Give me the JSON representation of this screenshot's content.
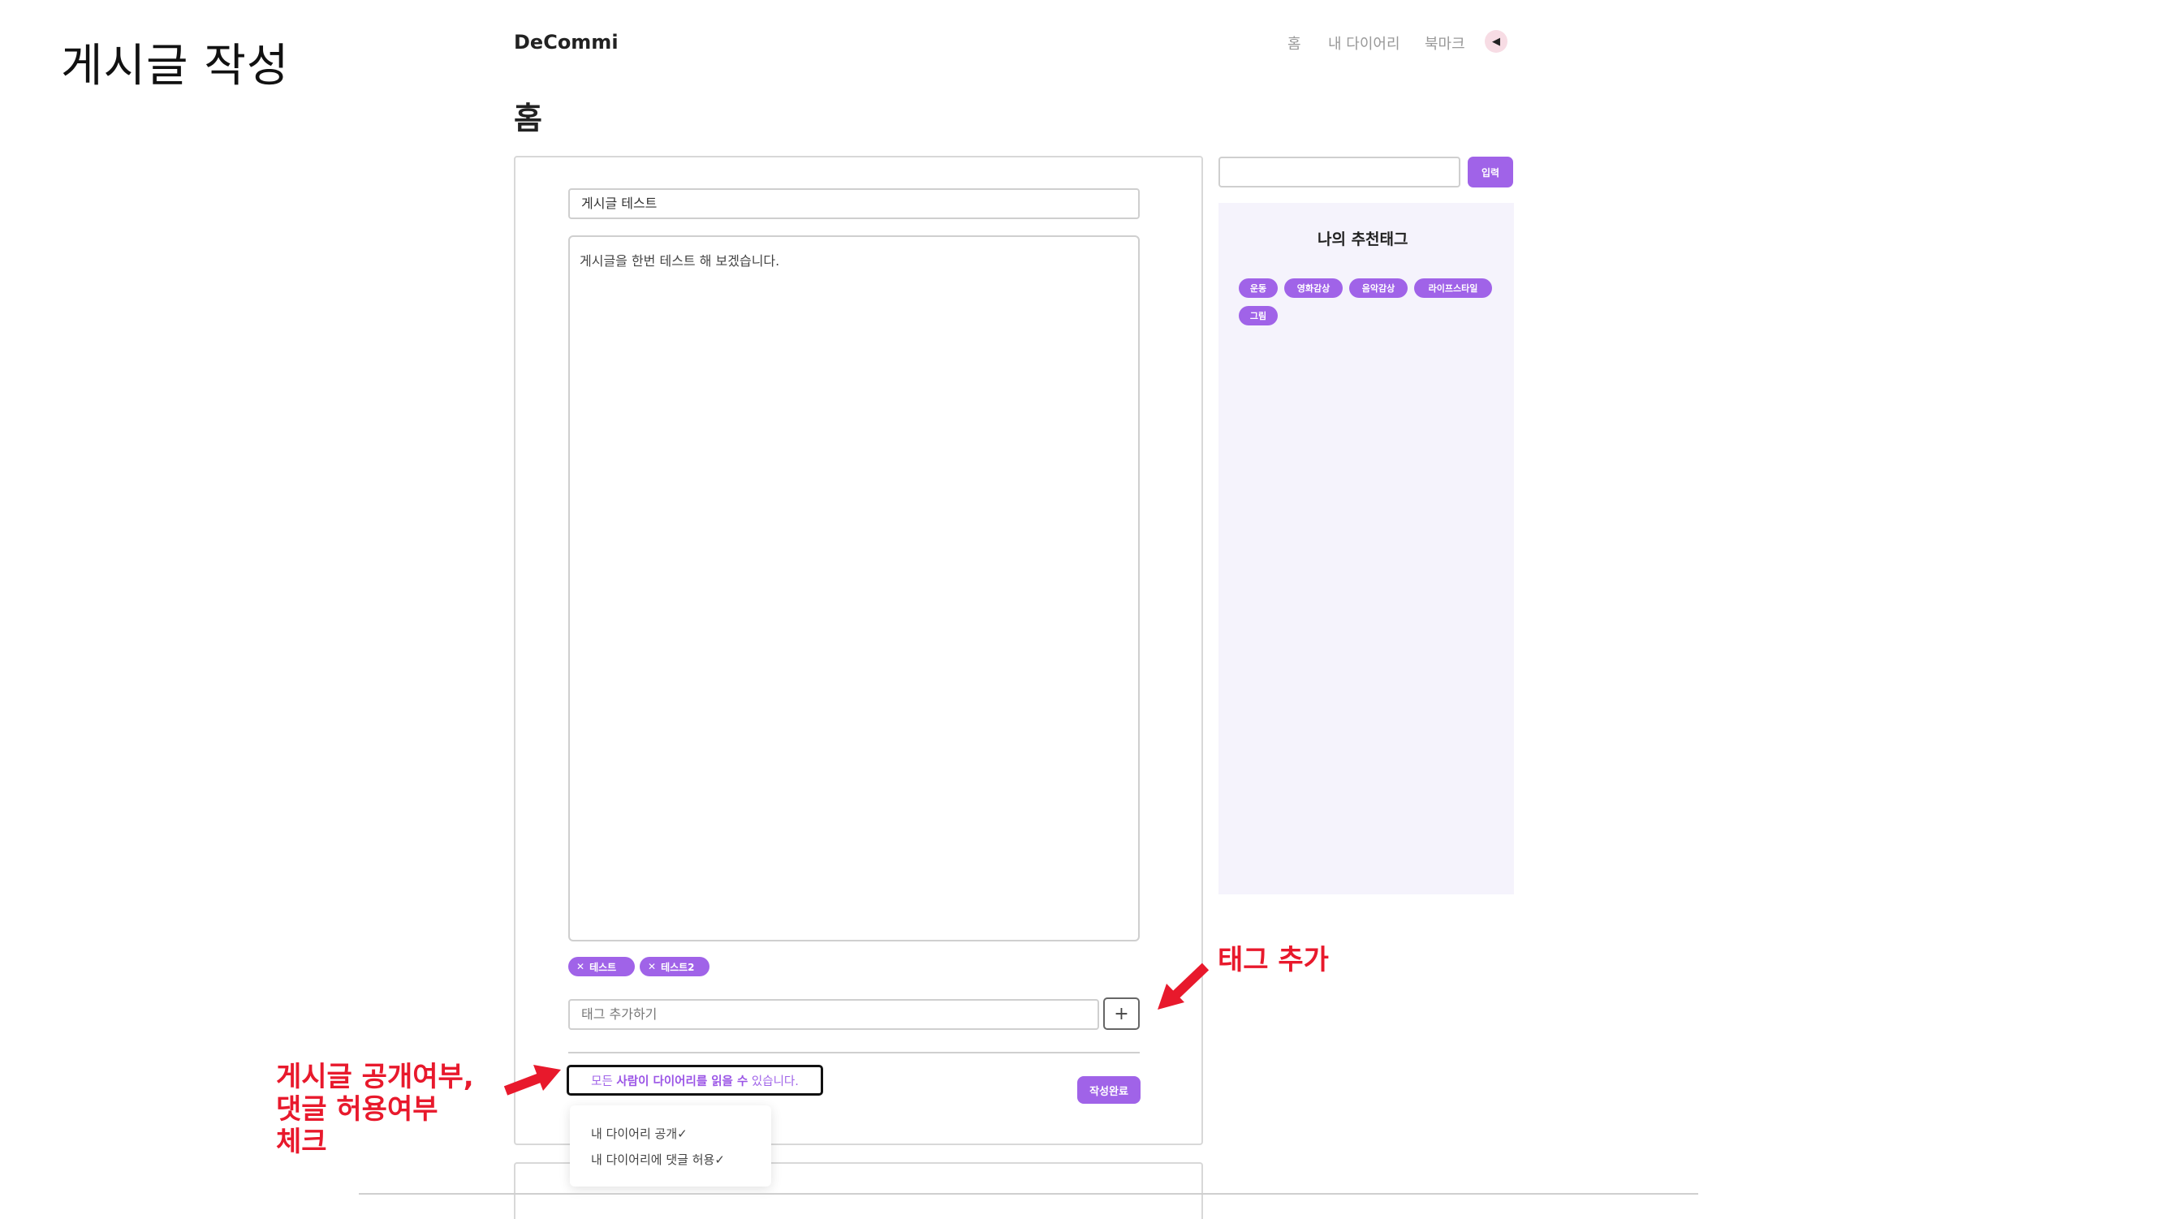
{
  "slide": {
    "title": "게시글 작성"
  },
  "header": {
    "brand": "DeCommi",
    "nav": {
      "home": "홈",
      "my_diary": "내 다이어리",
      "bookmark": "북마크"
    },
    "toggle_glyph": "◀"
  },
  "page": {
    "title": "홈"
  },
  "editor": {
    "title_value": "게시글 테스트",
    "body_value": "게시글을 한번 테스트 해 보겠습니다.",
    "chips": [
      {
        "remove": "✕",
        "label": "테스트"
      },
      {
        "remove": "✕",
        "label": "테스트2"
      }
    ],
    "tag_input_placeholder": "태그 추가하기",
    "add_tag_label": "+",
    "privacy": {
      "prefix": "모든",
      "highlight": "사람이 다이어리를 읽을 수",
      "suffix": "있습니다."
    },
    "dropdown": {
      "public_label": "내 다이어리 공개",
      "comment_label": "내 다이어리에 댓글 허용",
      "check": "✓"
    },
    "submit_label": "작성완료"
  },
  "sidebar": {
    "search_button": "입력",
    "tags_title": "나의 추천태그",
    "tags": [
      "운동",
      "영화감상",
      "음악감상",
      "라이프스타일",
      "그림"
    ]
  },
  "annotations": {
    "tag_add": "태그 추가",
    "privacy_lines": [
      "게시글 공개여부,",
      "댓글 허용여부",
      "체크"
    ]
  },
  "colors": {
    "accent": "#a063e8",
    "annotation": "#e8192c",
    "panel_bg": "#f5f3fc"
  },
  "icons": {
    "toggle": "left-triangle-icon",
    "add": "plus-icon",
    "remove": "close-icon",
    "check": "check-icon",
    "annotation": "red-arrow-icon"
  }
}
